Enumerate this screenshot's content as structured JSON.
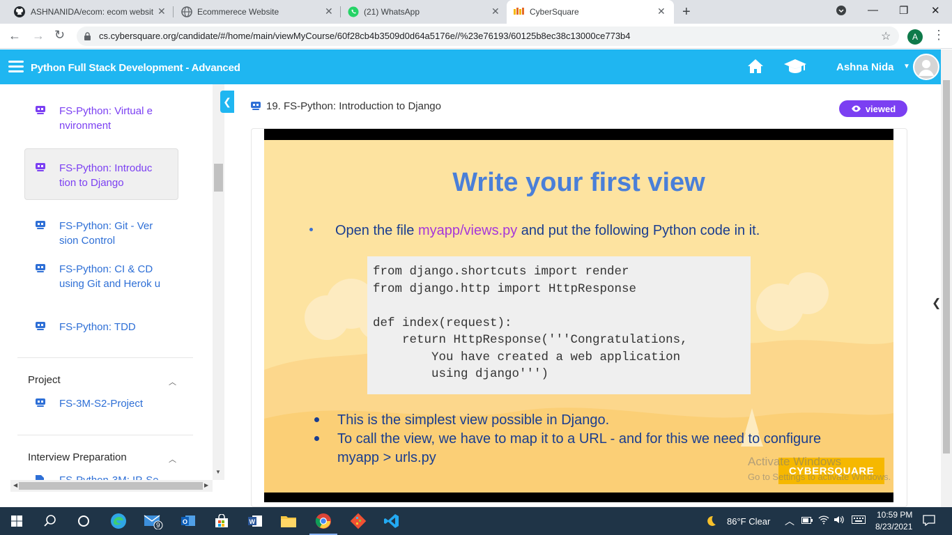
{
  "browser": {
    "tabs": [
      {
        "title": "ASHNANIDA/ecom: ecom websit",
        "icon": "github-icon"
      },
      {
        "title": "Ecommerece Website",
        "icon": "globe-icon"
      },
      {
        "title": "(21) WhatsApp",
        "icon": "whatsapp-icon"
      },
      {
        "title": "CyberSquare",
        "icon": "cybersquare-icon",
        "active": true
      }
    ],
    "url": "cs.cybersquare.org/candidate/#/home/main/viewMyCourse/60f28cb4b3509d0d64a5176e//%23e76193/60125b8ec38c13000ce773b4",
    "profile_initial": "A"
  },
  "header": {
    "title": "Python Full Stack Development - Advanced",
    "user_name": "Ashna Nida",
    "bg_color": "#1fb6f1"
  },
  "sidebar": {
    "items": [
      {
        "label": "FS-Python: Virtual e nvironment"
      },
      {
        "label": "FS-Python: Introduc tion to Django",
        "active": true
      },
      {
        "label": "FS-Python: Git - Ver sion Control"
      },
      {
        "label": "FS-Python: CI & CD using Git and Herok u"
      },
      {
        "label": "FS-Python: TDD"
      }
    ],
    "sections": [
      {
        "title": "Project",
        "items": [
          {
            "label": "FS-3M-S2-Project"
          }
        ]
      },
      {
        "title": "Interview Preparation",
        "items": [
          {
            "label": "FS-Python-3M: IP-Se"
          }
        ]
      }
    ]
  },
  "lesson": {
    "title": "19. FS-Python: Introduction to Django",
    "status_badge": "viewed",
    "accent_color": "#7b3ff2"
  },
  "slide": {
    "title": "Write your first view",
    "bullet1_pre": "Open the file ",
    "bullet1_file": "myapp/views.py",
    "bullet1_post": " and put the following Python code in it.",
    "code": "from django.shortcuts import render\nfrom django.http import HttpResponse\n\ndef index(request):\n    return HttpResponse('''Congratulations,\n        You have created a web application\n        using django''')",
    "bullet2": "This is the simplest view possible in Django.",
    "bullet3": "To call the view, we have to map it to a URL - and for this we need to configure myapp > urls.py",
    "brand": "CYBERSQUARE"
  },
  "watermark": {
    "line1": "Activate Windows",
    "line2": "Go to Settings to activate Windows."
  },
  "taskbar": {
    "weather": "86°F  Clear",
    "time": "10:59 PM",
    "date": "8/23/2021",
    "mail_badge": "9"
  }
}
